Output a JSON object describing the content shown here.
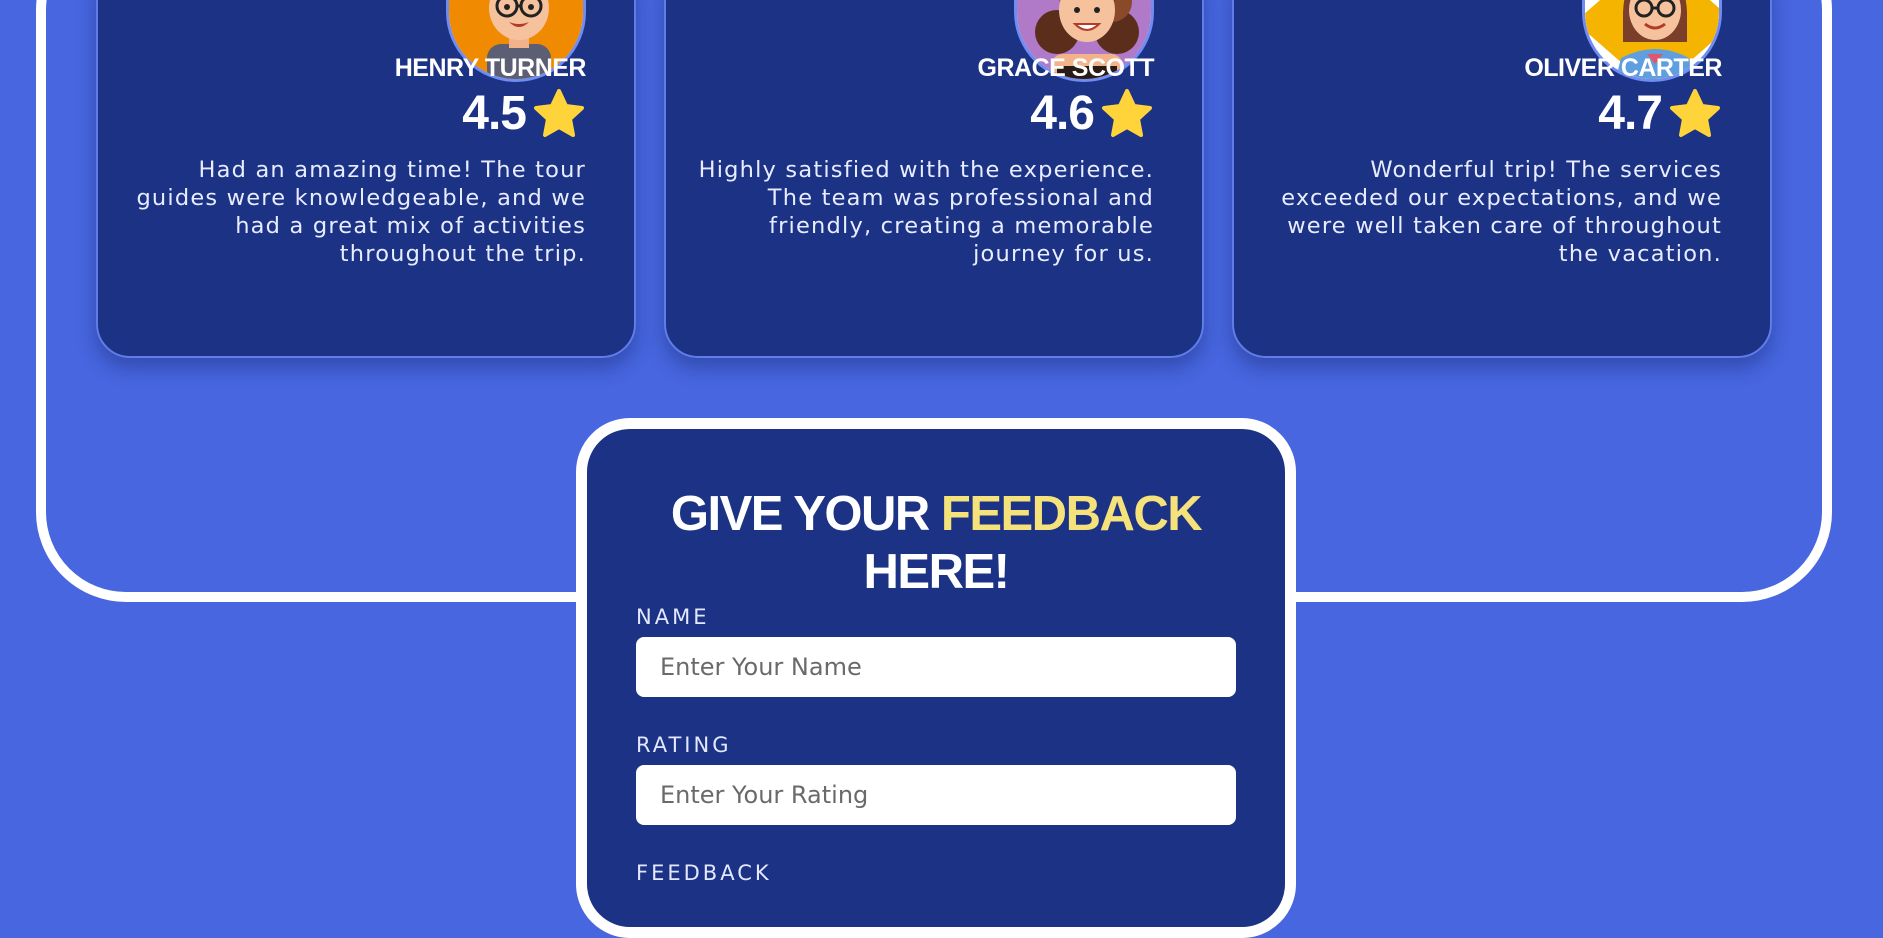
{
  "testimonials": [
    {
      "name": "HENRY TURNER",
      "rating": "4.5",
      "text": "Had an amazing time! The tour guides were knowledgeable, and we had a great mix of activities throughout the trip.",
      "avatar_icon": "avatar-man-glasses-icon",
      "avatar_bg": "#f08a00"
    },
    {
      "name": "GRACE SCOTT",
      "rating": "4.6",
      "text": "Highly satisfied with the experience. The team was professional and friendly, creating a memorable journey for us.",
      "avatar_icon": "avatar-woman-curly-hair-icon",
      "avatar_bg": "#b07ac9"
    },
    {
      "name": "OLIVER CARTER",
      "rating": "4.7",
      "text": "Wonderful trip! The services exceeded our expectations, and we were well taken care of throughout the vacation.",
      "avatar_icon": "avatar-woman-glasses-icon",
      "avatar_bg": "#f5b400"
    }
  ],
  "feedback_form": {
    "title_part1": "GIVE YOUR ",
    "title_accent": "FEEDBACK",
    "title_part2": "HERE!",
    "name_label": "NAME",
    "name_placeholder": "Enter Your Name",
    "rating_label": "RATING",
    "rating_placeholder": "Enter Your Rating",
    "feedback_label": "FEEDBACK"
  },
  "colors": {
    "page_bg": "#4766df",
    "card_bg": "#1c3285",
    "accent": "#f6e27a",
    "star": "#ffd43b"
  }
}
